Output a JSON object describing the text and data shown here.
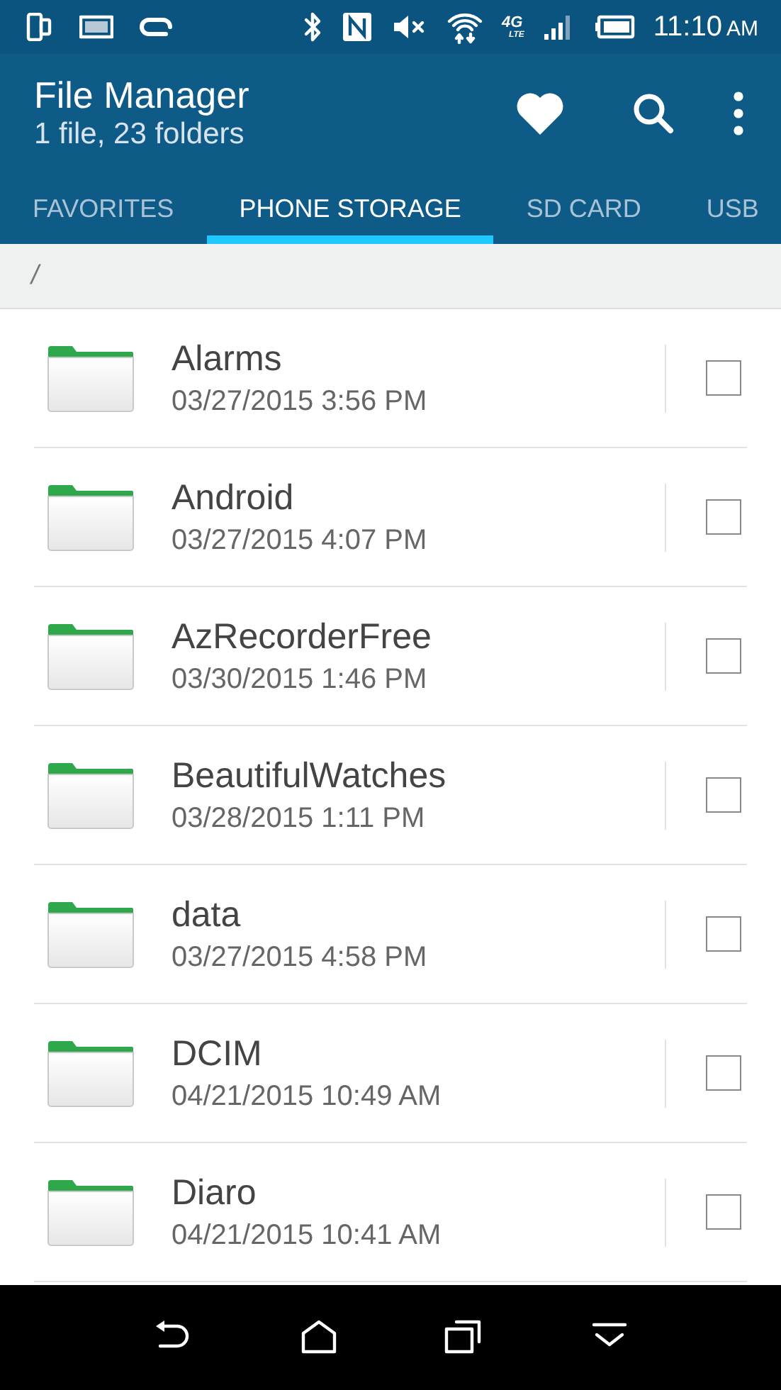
{
  "status_bar": {
    "network": "4G",
    "network_sub": "LTE",
    "time": "11:10",
    "meridiem": "AM"
  },
  "header": {
    "title": "File Manager",
    "subtitle": "1 file, 23 folders"
  },
  "tabs": [
    {
      "label": "FAVORITES",
      "selected": false
    },
    {
      "label": "PHONE STORAGE",
      "selected": true
    },
    {
      "label": "SD CARD",
      "selected": false
    },
    {
      "label": "USB",
      "selected": false
    }
  ],
  "path": "/",
  "rows": [
    {
      "name": "Alarms",
      "date": "03/27/2015 3:56 PM",
      "checked": false
    },
    {
      "name": "Android",
      "date": "03/27/2015 4:07 PM",
      "checked": false
    },
    {
      "name": "AzRecorderFree",
      "date": "03/30/2015 1:46 PM",
      "checked": false
    },
    {
      "name": "BeautifulWatches",
      "date": "03/28/2015 1:11 PM",
      "checked": false
    },
    {
      "name": "data",
      "date": "03/27/2015 4:58 PM",
      "checked": false
    },
    {
      "name": "DCIM",
      "date": "04/21/2015 10:49 AM",
      "checked": false
    },
    {
      "name": "Diaro",
      "date": "04/21/2015 10:41 AM",
      "checked": false
    }
  ]
}
